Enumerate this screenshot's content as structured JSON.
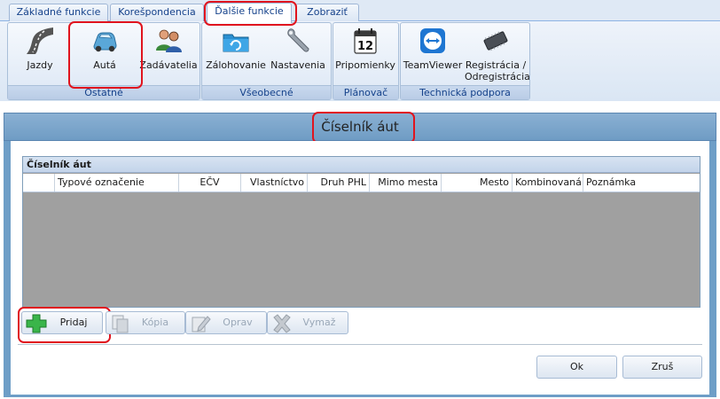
{
  "tabs": [
    {
      "label": "Základné funkcie"
    },
    {
      "label": "Korešpondencia"
    },
    {
      "label": "Ďalšie funkcie"
    },
    {
      "label": "Zobraziť"
    }
  ],
  "ribbon": {
    "groups": [
      {
        "label": "Ostatné",
        "buttons": [
          {
            "label": "Jazdy"
          },
          {
            "label": "Autá"
          },
          {
            "label": "Zadávatelia"
          }
        ]
      },
      {
        "label": "Všeobecné",
        "buttons": [
          {
            "label": "Zálohovanie"
          },
          {
            "label": "Nastavenia"
          }
        ]
      },
      {
        "label": "Plánovač",
        "buttons": [
          {
            "label": "Pripomienky",
            "calendar_day": "12"
          }
        ]
      },
      {
        "label": "Technická podpora",
        "buttons": [
          {
            "label": "TeamViewer"
          },
          {
            "label_line1": "Registrácia /",
            "label_line2": "Odregistrácia"
          }
        ]
      }
    ]
  },
  "dialog": {
    "title": "Číselník áut",
    "grid": {
      "caption": "Číselník áut",
      "columns": [
        "Typové označenie",
        "EČV",
        "Vlastníctvo",
        "Druh PHL",
        "Mimo mesta",
        "Mesto",
        "Kombinovaná",
        "Poznámka"
      ],
      "rows": []
    },
    "actions": {
      "add": "Pridaj",
      "copy": "Kópia",
      "edit": "Oprav",
      "delete": "Vymaž"
    },
    "ok": "Ok",
    "cancel": "Zruš"
  },
  "colors": {
    "highlight": "#e0141e",
    "dialog_frame": "#6e9ec7",
    "grid_empty": "#a0a0a0",
    "ribbon_text": "#15428b"
  }
}
